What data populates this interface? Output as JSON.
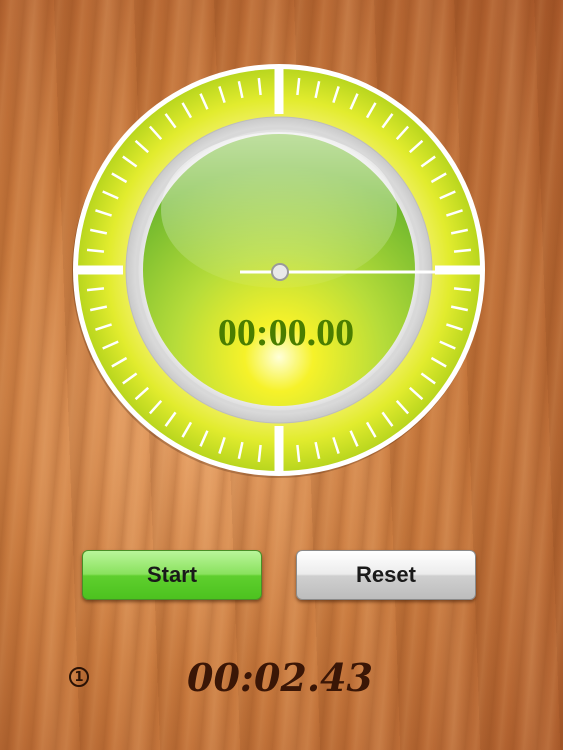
{
  "stopwatch": {
    "display": "00:00.00",
    "hand_seconds": 0
  },
  "buttons": {
    "start_label": "Start",
    "reset_label": "Reset"
  },
  "lap": {
    "index": "1",
    "time": "00:02.43"
  },
  "colors": {
    "dial_face": "#b8d84a",
    "bezel": "#e6ef3a",
    "start_button": "#6bd63a",
    "reset_button": "#d8d8d8",
    "time_text": "#4a7d00",
    "lap_text": "#3a1606"
  }
}
